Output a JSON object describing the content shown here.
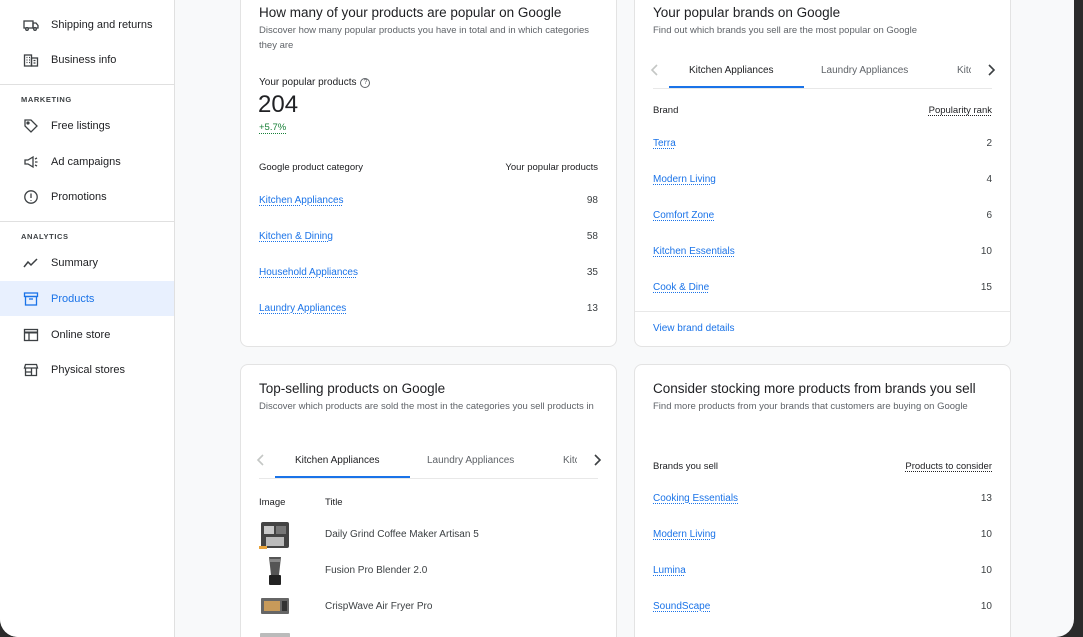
{
  "sidebar": {
    "items_top": [
      {
        "label": "Shipping and returns",
        "icon": "truck-icon"
      },
      {
        "label": "Business info",
        "icon": "building-icon"
      }
    ],
    "marketing_label": "MARKETING",
    "marketing_items": [
      {
        "label": "Free listings",
        "icon": "tag-icon"
      },
      {
        "label": "Ad campaigns",
        "icon": "megaphone-icon"
      },
      {
        "label": "Promotions",
        "icon": "promotion-icon"
      }
    ],
    "analytics_label": "ANALYTICS",
    "analytics_items": [
      {
        "label": "Summary",
        "icon": "trend-icon"
      },
      {
        "label": "Products",
        "icon": "archive-icon",
        "active": true
      },
      {
        "label": "Online store",
        "icon": "browser-icon"
      },
      {
        "label": "Physical stores",
        "icon": "store-icon"
      }
    ]
  },
  "popular_products": {
    "title": "How many of your products are popular on Google",
    "subtitle": "Discover how many popular products you have in total and in which categories they are",
    "metric_label": "Your popular products",
    "metric_value": "204",
    "metric_change": "+5.7%",
    "col_category": "Google product category",
    "col_count": "Your popular products",
    "rows": [
      {
        "name": "Kitchen Appliances",
        "value": "98"
      },
      {
        "name": "Kitchen & Dining",
        "value": "58"
      },
      {
        "name": "Household Appliances",
        "value": "35"
      },
      {
        "name": "Laundry Appliances",
        "value": "13"
      }
    ]
  },
  "popular_brands": {
    "title": "Your popular brands on Google",
    "subtitle": "Find out which brands you sell are the most popular on Google",
    "tabs": [
      "Kitchen Appliances",
      "Laundry Appliances",
      "Kitc"
    ],
    "col_brand": "Brand",
    "col_rank": "Popularity rank",
    "rows": [
      {
        "name": "Terra",
        "value": "2"
      },
      {
        "name": "Modern Living",
        "value": "4"
      },
      {
        "name": "Comfort Zone",
        "value": "6"
      },
      {
        "name": "Kitchen Essentials",
        "value": "10"
      },
      {
        "name": "Cook & Dine",
        "value": "15"
      }
    ],
    "footer_link": "View brand details"
  },
  "top_selling": {
    "title": "Top-selling products on Google",
    "subtitle": "Discover which products are sold the most in the categories you sell products in",
    "tabs": [
      "Kitchen Appliances",
      "Laundry Appliances",
      "Kitc"
    ],
    "col_image": "Image",
    "col_title": "Title",
    "rows": [
      {
        "title": "Daily Grind Coffee Maker Artisan 5",
        "image": "coffee-maker-image"
      },
      {
        "title": "Fusion Pro Blender 2.0",
        "image": "blender-image"
      },
      {
        "title": "CrispWave Air Fryer Pro",
        "image": "air-fryer-image"
      }
    ]
  },
  "consider_stocking": {
    "title": "Consider stocking more products from brands you sell",
    "subtitle": "Find more products from your brands that customers are buying on Google",
    "col_brand": "Brands you sell",
    "col_products": "Products to consider",
    "rows": [
      {
        "name": "Cooking Essentials",
        "value": "13"
      },
      {
        "name": "Modern Living",
        "value": "10"
      },
      {
        "name": "Lumina",
        "value": "10"
      },
      {
        "name": "SoundScape",
        "value": "10"
      }
    ]
  },
  "colors": {
    "accent": "#1a73e8",
    "positive": "#188038",
    "active_bg": "#e8f0fe"
  }
}
